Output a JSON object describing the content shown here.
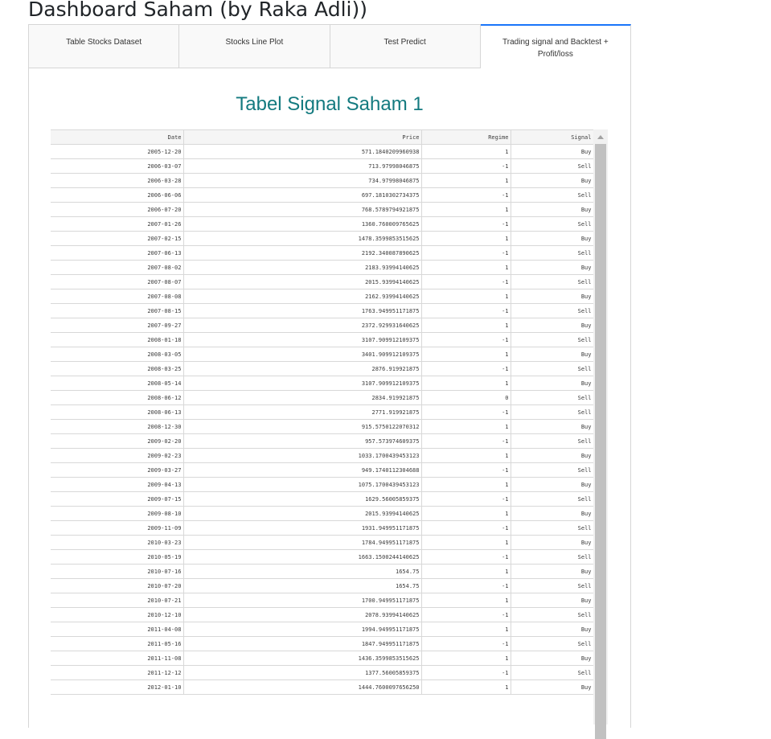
{
  "page": {
    "title": "Dashboard Saham (by Raka Adli))"
  },
  "tabs": [
    {
      "label": "Table Stocks Dataset",
      "selected": false
    },
    {
      "label": "Stocks Line Plot",
      "selected": false
    },
    {
      "label": "Test Predict",
      "selected": false
    },
    {
      "label": "Trading signal and Backtest + Profit/loss",
      "selected": true
    }
  ],
  "section": {
    "title": "Tabel Signal Saham 1"
  },
  "table": {
    "columns": [
      "Date",
      "Price",
      "Regime",
      "Signal"
    ],
    "rows": [
      [
        "2005-12-20",
        "571.1840209960938",
        "1",
        "Buy"
      ],
      [
        "2006-03-07",
        "713.97998046875",
        "-1",
        "Sell"
      ],
      [
        "2006-03-28",
        "734.97998046875",
        "1",
        "Buy"
      ],
      [
        "2006-06-06",
        "697.1810302734375",
        "-1",
        "Sell"
      ],
      [
        "2006-07-20",
        "768.5789794921875",
        "1",
        "Buy"
      ],
      [
        "2007-01-26",
        "1360.760009765625",
        "-1",
        "Sell"
      ],
      [
        "2007-02-15",
        "1478.3599853515625",
        "1",
        "Buy"
      ],
      [
        "2007-06-13",
        "2192.340087890625",
        "-1",
        "Sell"
      ],
      [
        "2007-08-02",
        "2183.93994140625",
        "1",
        "Buy"
      ],
      [
        "2007-08-07",
        "2015.93994140625",
        "-1",
        "Sell"
      ],
      [
        "2007-08-08",
        "2162.93994140625",
        "1",
        "Buy"
      ],
      [
        "2007-08-15",
        "1763.949951171875",
        "-1",
        "Sell"
      ],
      [
        "2007-09-27",
        "2372.929931640625",
        "1",
        "Buy"
      ],
      [
        "2008-01-18",
        "3107.909912109375",
        "-1",
        "Sell"
      ],
      [
        "2008-03-05",
        "3401.909912109375",
        "1",
        "Buy"
      ],
      [
        "2008-03-25",
        "2876.919921875",
        "-1",
        "Sell"
      ],
      [
        "2008-05-14",
        "3107.909912109375",
        "1",
        "Buy"
      ],
      [
        "2008-06-12",
        "2834.919921875",
        "0",
        "Sell"
      ],
      [
        "2008-06-13",
        "2771.919921875",
        "-1",
        "Sell"
      ],
      [
        "2008-12-30",
        "915.5750122070312",
        "1",
        "Buy"
      ],
      [
        "2009-02-20",
        "957.573974609375",
        "-1",
        "Sell"
      ],
      [
        "2009-02-23",
        "1033.1700439453123",
        "1",
        "Buy"
      ],
      [
        "2009-03-27",
        "949.1740112304688",
        "-1",
        "Sell"
      ],
      [
        "2009-04-13",
        "1075.1700439453123",
        "1",
        "Buy"
      ],
      [
        "2009-07-15",
        "1629.56005859375",
        "-1",
        "Sell"
      ],
      [
        "2009-08-10",
        "2015.93994140625",
        "1",
        "Buy"
      ],
      [
        "2009-11-09",
        "1931.949951171875",
        "-1",
        "Sell"
      ],
      [
        "2010-03-23",
        "1784.949951171875",
        "1",
        "Buy"
      ],
      [
        "2010-05-19",
        "1663.1500244140625",
        "-1",
        "Sell"
      ],
      [
        "2010-07-16",
        "1654.75",
        "1",
        "Buy"
      ],
      [
        "2010-07-20",
        "1654.75",
        "-1",
        "Sell"
      ],
      [
        "2010-07-21",
        "1700.949951171875",
        "1",
        "Buy"
      ],
      [
        "2010-12-10",
        "2078.93994140625",
        "-1",
        "Sell"
      ],
      [
        "2011-04-08",
        "1994.949951171875",
        "1",
        "Buy"
      ],
      [
        "2011-05-16",
        "1847.949951171875",
        "-1",
        "Sell"
      ],
      [
        "2011-11-08",
        "1436.3599853515625",
        "1",
        "Buy"
      ],
      [
        "2011-12-12",
        "1377.56005859375",
        "-1",
        "Sell"
      ],
      [
        "2012-01-10",
        "1444.7600097656250",
        "1",
        "Buy"
      ]
    ]
  },
  "colors": {
    "title_teal": "#137a7f",
    "tab_accent": "#1975FA"
  }
}
